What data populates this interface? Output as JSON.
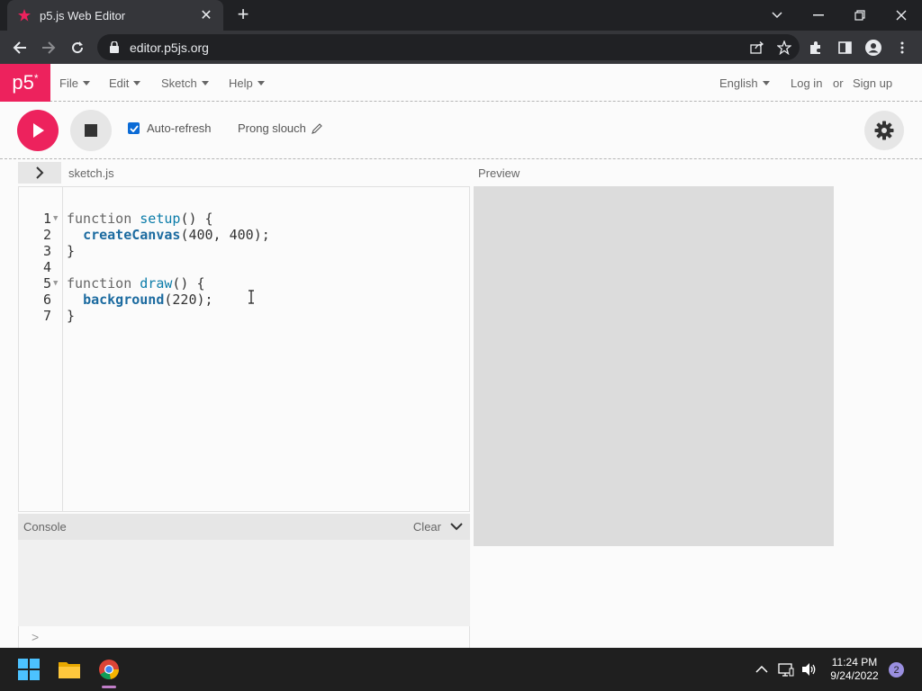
{
  "browser": {
    "tab_title": "p5.js Web Editor",
    "url": "editor.p5js.org"
  },
  "nav": {
    "logo": "p5",
    "logo_sup": "*",
    "menus": [
      "File",
      "Edit",
      "Sketch",
      "Help"
    ],
    "language": "English",
    "login": "Log in",
    "or": "or",
    "signup": "Sign up"
  },
  "toolbar": {
    "auto_refresh_label": "Auto-refresh",
    "auto_refresh_checked": true,
    "project_name": "Prong slouch"
  },
  "editor": {
    "filename": "sketch.js",
    "preview_label": "Preview",
    "lines": [
      {
        "n": "1",
        "fold": true
      },
      {
        "n": "2",
        "fold": false
      },
      {
        "n": "3",
        "fold": false
      },
      {
        "n": "4",
        "fold": false
      },
      {
        "n": "5",
        "fold": true
      },
      {
        "n": "6",
        "fold": false
      },
      {
        "n": "7",
        "fold": false
      }
    ],
    "code": {
      "l1_kw": "function",
      "l1_fn": "setup",
      "l1_rest": "() {",
      "l2_indent": "  ",
      "l2_bi": "createCanvas",
      "l2_rest": "(400, 400);",
      "l3": "}",
      "l4": "",
      "l5_kw": "function",
      "l5_fn": "draw",
      "l5_rest": "() {",
      "l6_indent": "  ",
      "l6_bi": "background",
      "l6_rest": "(220);",
      "l7": "}"
    }
  },
  "console": {
    "label": "Console",
    "clear": "Clear",
    "prompt": ">"
  },
  "taskbar": {
    "time": "11:24 PM",
    "date": "9/24/2022",
    "notifications": "2"
  },
  "colors": {
    "p5_pink": "#ed225d",
    "accent_blue": "#0b6bd6"
  }
}
